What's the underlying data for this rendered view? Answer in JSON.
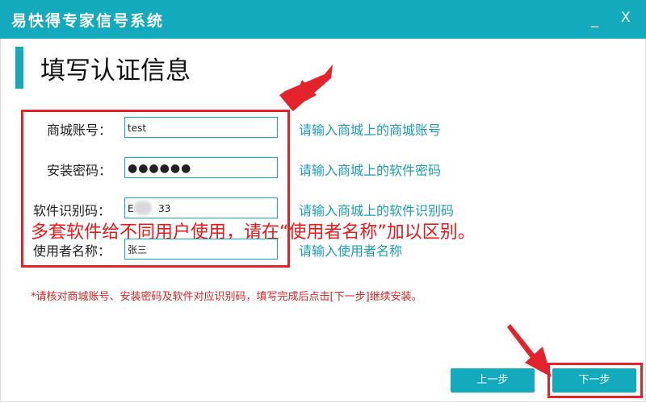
{
  "window": {
    "title": "易快得专家信号系统",
    "minimize_glyph": "_",
    "close_glyph": "X"
  },
  "heading": "填写认证信息",
  "form": {
    "rows": [
      {
        "label": "商城账号：",
        "value": "test",
        "hint": "请输入商城上的商城账号"
      },
      {
        "label": "安装密码：",
        "value": "●●●●●●",
        "hint": "请输入商城上的软件密码"
      },
      {
        "label": "软件识别码：",
        "value": "E        33",
        "hint": "请输入商城上的软件识别码"
      },
      {
        "label": "使用者名称：",
        "value": "张三",
        "hint": "请输入使用者名称"
      }
    ]
  },
  "annotation_note": "多套软件给不同用户使用，请在“使用者名称”加以区别。",
  "footnote": "*请核对商城账号、安装密码及软件对应识别码，填写完成后点击[下一步]继续安装。",
  "buttons": {
    "prev": "上一步",
    "next": "下一步"
  },
  "colors": {
    "titlebar": "#13aabd",
    "accent_text": "#1c9db5",
    "annotation_red": "#e4222c"
  }
}
